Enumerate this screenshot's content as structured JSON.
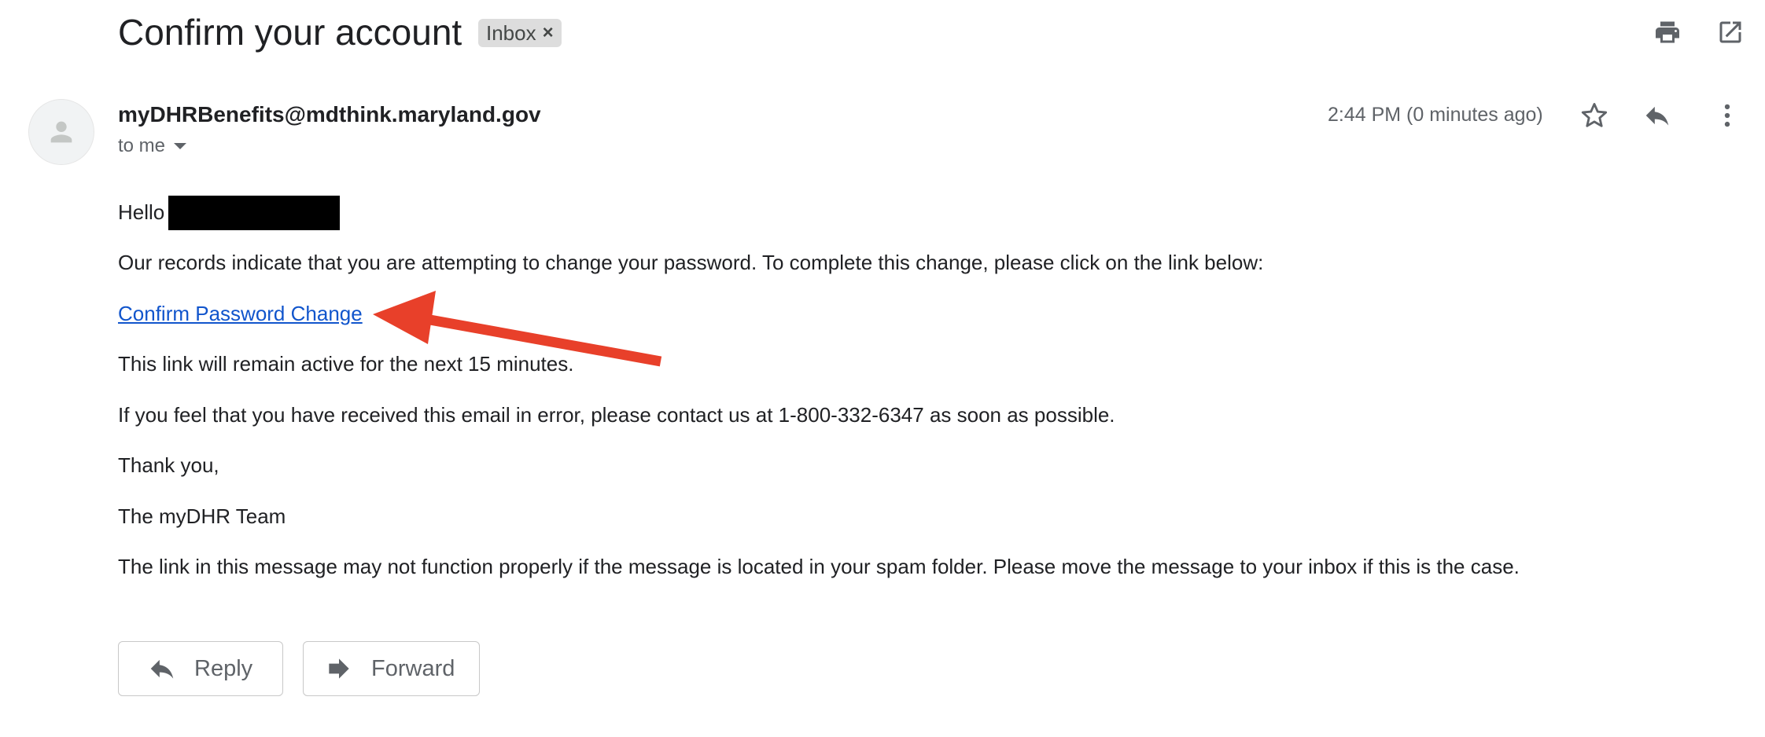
{
  "header": {
    "subject": "Confirm your account",
    "label": "Inbox",
    "label_remove": "×",
    "actions": [
      "print-icon",
      "open-in-new-window-icon"
    ]
  },
  "message": {
    "sender": "myDHRBenefits@mdthink.maryland.gov",
    "recipient": "to me",
    "time": "2:44 PM (0 minutes ago)",
    "actions": [
      "star-icon",
      "reply-icon",
      "more-vert-icon"
    ]
  },
  "body": {
    "greeting": "Hello",
    "p1": "Our records indicate that you are attempting to change your password. To complete this change, please click on the link below:",
    "link_text": "Confirm Password Change",
    "p2": "This link will remain active for the next 15 minutes.",
    "p3": "If you feel that you have received this email in error, please contact us at 1-800-332-6347 as soon as possible.",
    "p4": "Thank you,",
    "p5": "The myDHR Team",
    "p6": "The link in this message may not function properly if the message is located in your spam folder. Please move the message to your inbox if this is the case."
  },
  "footer": {
    "reply_label": "Reply",
    "forward_label": "Forward"
  },
  "colors": {
    "link": "#1155cc",
    "annotation_arrow": "#e8402a",
    "icon": "#5f6368"
  }
}
